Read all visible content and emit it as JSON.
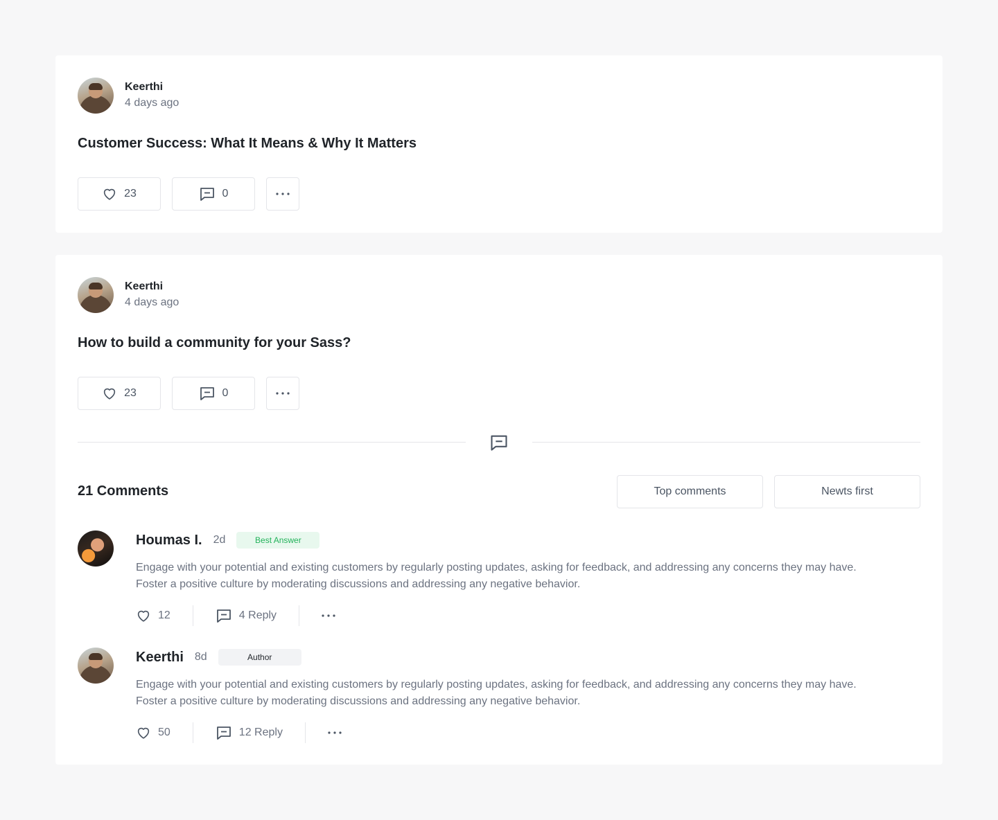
{
  "posts": [
    {
      "author": "Keerthi",
      "time": "4 days ago",
      "title": "Customer Success: What It Means & Why It Matters",
      "likes": "23",
      "comments": "0"
    },
    {
      "author": "Keerthi",
      "time": "4 days ago",
      "title": "How to build a community for your Sass?",
      "likes": "23",
      "comments": "0"
    }
  ],
  "comments_section": {
    "title": "21 Comments",
    "sort_top": "Top comments",
    "sort_new": "Newts first",
    "items": [
      {
        "author": "Houmas I.",
        "time": "2d",
        "badge": "Best Answer",
        "text_line1": "Engage with your potential and existing customers by regularly posting updates, asking for feedback, and addressing any concerns they may have.",
        "text_line2": "Foster a positive culture by moderating discussions and addressing any negative behavior.",
        "likes": "12",
        "replies": "4 Reply"
      },
      {
        "author": "Keerthi",
        "time": "8d",
        "badge": "Author",
        "text_line1": "Engage with your potential and existing customers by regularly posting updates, asking for feedback, and addressing any concerns they may have.",
        "text_line2": "Foster a positive culture by moderating discussions and addressing any negative behavior.",
        "likes": "50",
        "replies": "12 Reply"
      }
    ]
  },
  "icons": {
    "like": "heart-icon",
    "comment": "comment-icon",
    "more": "more-horizontal-icon"
  },
  "colors": {
    "background": "#f7f7f8",
    "card": "#ffffff",
    "border": "#e4e5e9",
    "text_primary": "#1f2328",
    "text_secondary": "#6b7280",
    "best_answer_bg": "#e8f8ee",
    "best_answer_text": "#22b25a",
    "author_badge_bg": "#f2f3f5"
  }
}
